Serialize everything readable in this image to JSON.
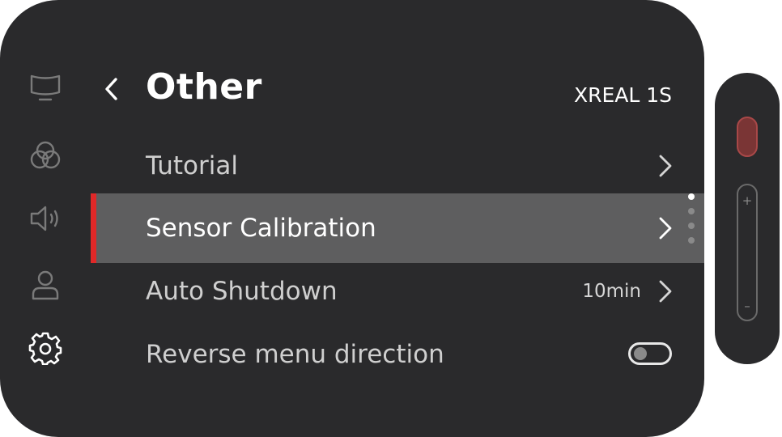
{
  "sidebar": {
    "items": [
      {
        "icon": "display-icon"
      },
      {
        "icon": "color-circles-icon"
      },
      {
        "icon": "speaker-icon"
      },
      {
        "icon": "user-icon"
      },
      {
        "icon": "gear-icon",
        "active": true
      }
    ]
  },
  "header": {
    "title": "Other",
    "device": "XREAL 1S"
  },
  "menu": {
    "items": [
      {
        "label": "Tutorial"
      },
      {
        "label": "Sensor Calibration",
        "selected": true
      },
      {
        "label": "Auto Shutdown",
        "value": "10min"
      },
      {
        "label": "Reverse menu direction",
        "toggle": false
      }
    ]
  },
  "remote": {
    "volume_up": "+",
    "volume_down": "–"
  },
  "colors": {
    "panel": "#2a2a2c",
    "selected_row": "#5e5e5f",
    "accent": "#e02828",
    "power_button": "#7a3535"
  }
}
